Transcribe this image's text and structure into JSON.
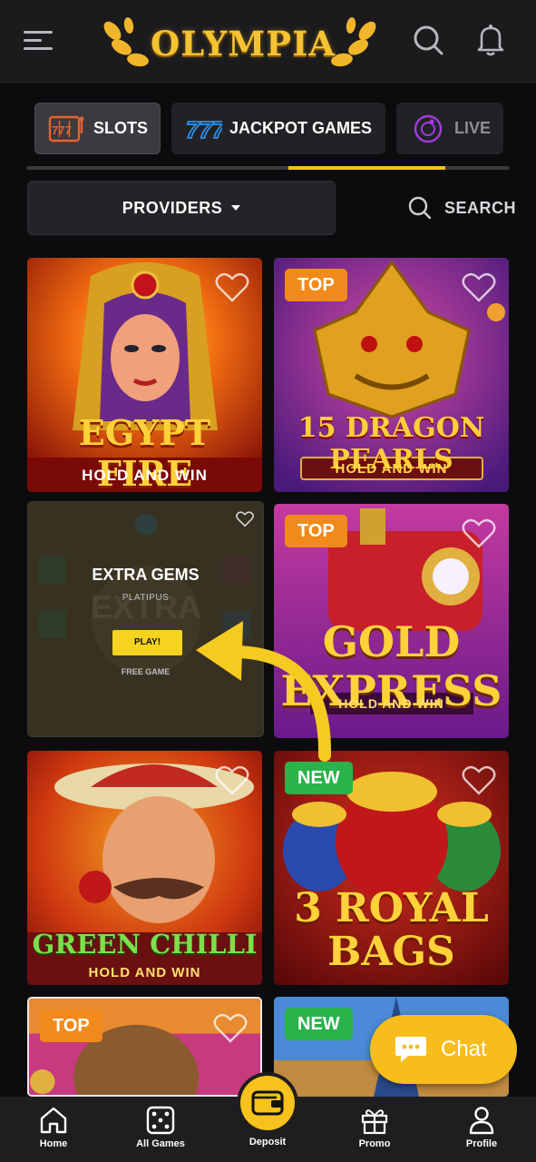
{
  "header": {
    "logo_text": "OLYMPIA",
    "menu_icon": "hamburger-icon",
    "search_icon": "search-icon",
    "bell_icon": "bell-icon"
  },
  "tabs": [
    {
      "label": "SLOTS",
      "icon": "slot-777-icon",
      "active": true
    },
    {
      "label": "JACKPOT GAMES",
      "icon": "jackpot-777-icon",
      "active": false
    },
    {
      "label": "LIVE",
      "icon": "roulette-icon",
      "active": false
    }
  ],
  "filters": {
    "providers_label": "PROVIDERS",
    "search_label": "SEARCH"
  },
  "games": [
    {
      "title_line1": "EGYPT FIRE",
      "title_line2": "HOLD AND WIN",
      "badge": ""
    },
    {
      "title_line1": "15 DRAGON PEARLS",
      "title_line2": "HOLD AND WIN",
      "badge": "TOP"
    },
    {
      "title_line1": "EXTRA GEMS",
      "provider": "PLATIPUS",
      "play_label": "PLAY!",
      "free_label": "FREE GAME",
      "badge": ""
    },
    {
      "title_line1": "GOLD EXPRESS",
      "title_line2": "HOLD AND WIN",
      "badge": "TOP"
    },
    {
      "title_line1": "GREEN CHILLI",
      "title_line2": "HOLD AND WIN",
      "badge": ""
    },
    {
      "title_line1": "3 ROYAL BAGS",
      "badge": "NEW"
    },
    {
      "badge": "TOP"
    },
    {
      "badge": "NEW"
    }
  ],
  "chat": {
    "label": "Chat"
  },
  "bottom_nav": [
    {
      "label": "Home",
      "icon": "home-icon"
    },
    {
      "label": "All Games",
      "icon": "dice-icon"
    },
    {
      "label": "Deposit",
      "icon": "wallet-icon"
    },
    {
      "label": "Promo",
      "icon": "gift-icon"
    },
    {
      "label": "Profile",
      "icon": "user-icon"
    }
  ],
  "colors": {
    "accent": "#f2c31c",
    "badge_top": "#f08a1a",
    "badge_new": "#29b34a",
    "background": "#0c0c0e"
  }
}
